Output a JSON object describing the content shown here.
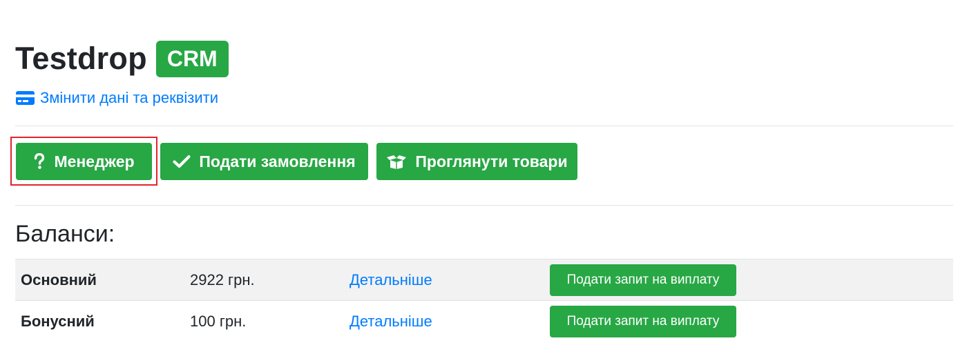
{
  "header": {
    "title": "Testdrop",
    "badge": "CRM"
  },
  "edit_link": {
    "label": "Змінити дані та реквізити",
    "icon": "credit-card-icon"
  },
  "actions": [
    {
      "label": "Менеджер",
      "icon": "question-icon"
    },
    {
      "label": "Подати замовлення",
      "icon": "check-icon"
    },
    {
      "label": "Проглянути товари",
      "icon": "box-open-icon"
    }
  ],
  "balances": {
    "title": "Баланси:",
    "rows": [
      {
        "name": "Основний",
        "amount": "2922 грн.",
        "details": "Детальніше",
        "action": "Подати запит на виплату"
      },
      {
        "name": "Бонусний",
        "amount": "100 грн.",
        "details": "Детальніше",
        "action": "Подати запит на виплату"
      }
    ]
  },
  "colors": {
    "success": "#28a745",
    "link": "#007bff",
    "highlight": "#e0242d",
    "text": "#212529"
  }
}
